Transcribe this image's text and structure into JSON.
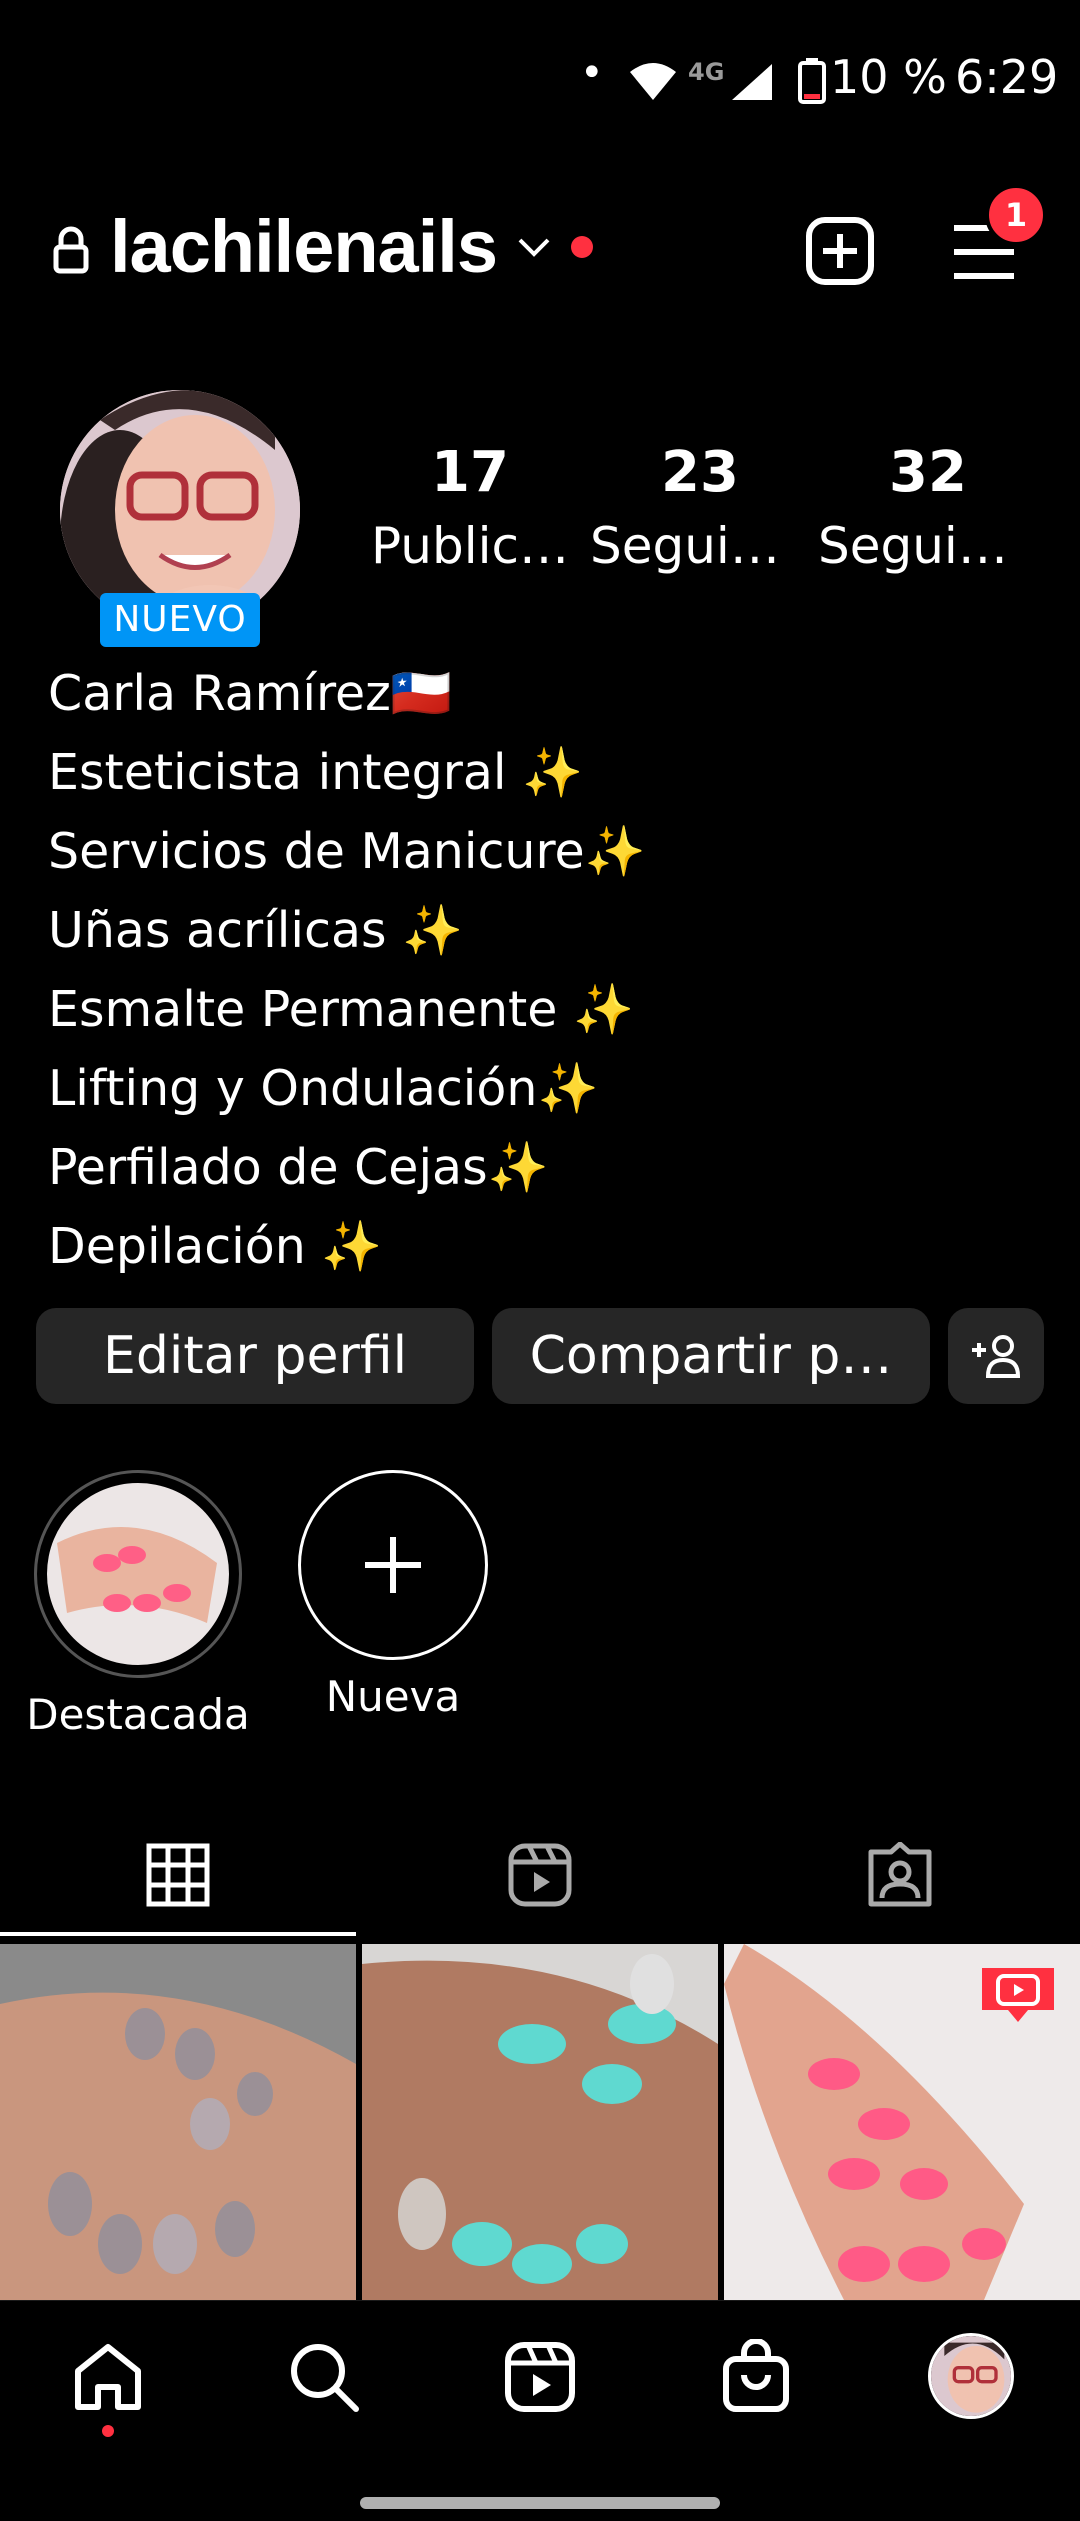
{
  "status_bar": {
    "dot": "•",
    "network": "4G",
    "battery": "10 %",
    "time": "6:29"
  },
  "header": {
    "username": "lachilenails",
    "notification_count": "1"
  },
  "profile": {
    "badge": "NUEVO",
    "stats": [
      {
        "value": "17",
        "label": "Public…"
      },
      {
        "value": "23",
        "label": "Seguid…"
      },
      {
        "value": "32",
        "label": "Seguidos"
      }
    ],
    "bio": [
      "Carla Ramírez🇨🇱",
      "Esteticista integral ✨",
      "Servicios de Manicure✨",
      "Uñas acrílicas ✨",
      "Esmalte Permanente ✨",
      "Lifting y Ondulación✨",
      "Perfilado de Cejas✨",
      "Depilación ✨"
    ]
  },
  "actions": {
    "edit": "Editar perfil",
    "share": "Compartir p…"
  },
  "highlights": [
    {
      "label": "Destacada"
    },
    {
      "label": "Nueva"
    }
  ],
  "colors": {
    "accent": "#0095f6",
    "notification": "#ff3040",
    "button_bg": "#262626"
  },
  "tabs": [
    "grid-icon",
    "reels-icon",
    "tagged-icon"
  ],
  "bottom_nav": [
    "home-icon",
    "search-icon",
    "reels-icon",
    "shop-icon",
    "profile-avatar"
  ]
}
